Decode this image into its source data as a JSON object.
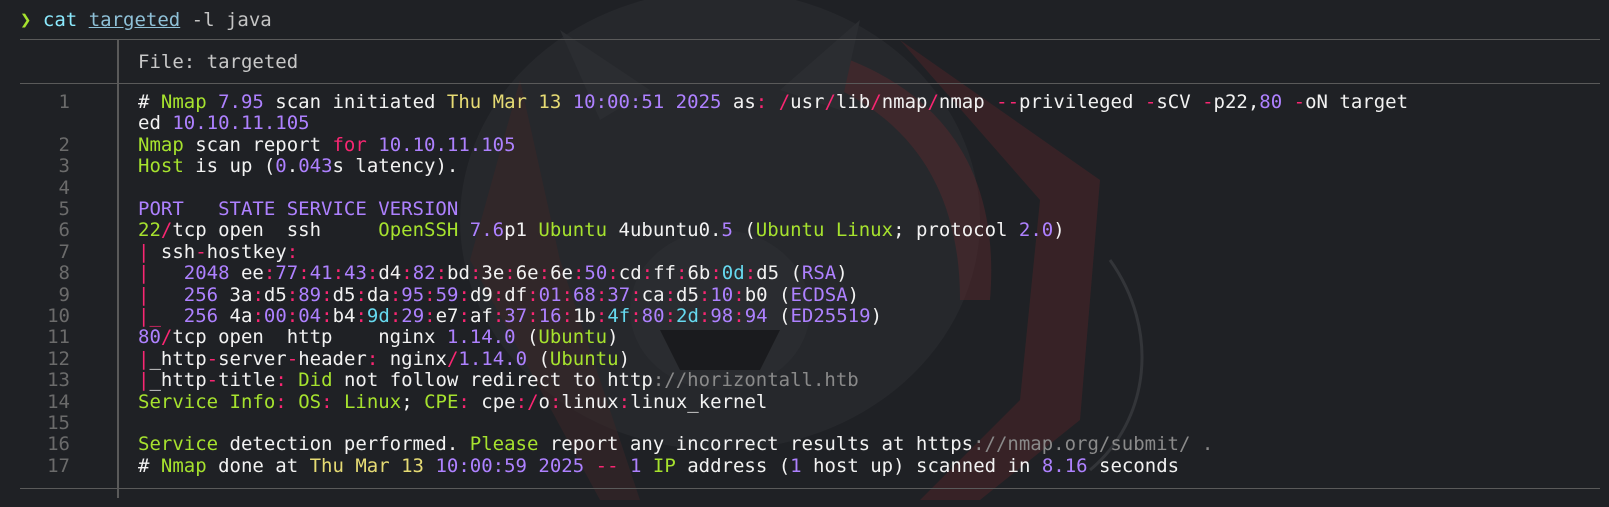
{
  "prompt": {
    "arrow": "❯",
    "command": "cat",
    "file_arg": "targeted",
    "flags": "-l java"
  },
  "file_header": "File: targeted",
  "line_numbers": [
    "1",
    "",
    "2",
    "3",
    "4",
    "5",
    "6",
    "7",
    "8",
    "9",
    "10",
    "11",
    "12",
    "13",
    "14",
    "15",
    "16",
    "17"
  ],
  "lines": [
    [
      [
        "w",
        "# "
      ],
      [
        "g",
        "Nmap "
      ],
      [
        "p",
        "7.95"
      ],
      [
        "w",
        " scan initiated "
      ],
      [
        "y",
        "Thu Mar 13 "
      ],
      [
        "p",
        "10:00:51 2025"
      ],
      [
        "w",
        " as"
      ],
      [
        "r",
        ":"
      ],
      [
        "w",
        " "
      ],
      [
        "r",
        "/"
      ],
      [
        "w",
        "usr"
      ],
      [
        "r",
        "/"
      ],
      [
        "w",
        "lib"
      ],
      [
        "r",
        "/"
      ],
      [
        "w",
        "nmap"
      ],
      [
        "r",
        "/"
      ],
      [
        "w",
        "nmap "
      ],
      [
        "r",
        "--"
      ],
      [
        "w",
        "privileged "
      ],
      [
        "r",
        "-"
      ],
      [
        "w",
        "sCV "
      ],
      [
        "r",
        "-"
      ],
      [
        "w",
        "p22,"
      ],
      [
        "p",
        "80"
      ],
      [
        "w",
        " "
      ],
      [
        "r",
        "-"
      ],
      [
        "w",
        "oN target"
      ]
    ],
    [
      [
        "w",
        "ed "
      ],
      [
        "p",
        "10.10.11.105"
      ]
    ],
    [
      [
        "g",
        "Nmap"
      ],
      [
        "w",
        " scan report "
      ],
      [
        "r",
        "for"
      ],
      [
        "w",
        " "
      ],
      [
        "p",
        "10.10.11.105"
      ]
    ],
    [
      [
        "g",
        "Host"
      ],
      [
        "w",
        " is up ("
      ],
      [
        "p",
        "0"
      ],
      [
        "w",
        "."
      ],
      [
        "p",
        "043"
      ],
      [
        "w",
        "s latency)."
      ]
    ],
    [
      [
        "w",
        ""
      ]
    ],
    [
      [
        "p",
        "PORT   STATE SERVICE VERSION"
      ]
    ],
    [
      [
        "g",
        "22"
      ],
      [
        "r",
        "/"
      ],
      [
        "w",
        "tcp open  ssh     "
      ],
      [
        "g",
        "OpenSSH "
      ],
      [
        "p",
        "7.6"
      ],
      [
        "w",
        "p1 "
      ],
      [
        "g",
        "Ubuntu"
      ],
      [
        "w",
        " 4ubuntu0."
      ],
      [
        "p",
        "5"
      ],
      [
        "w",
        " ("
      ],
      [
        "g",
        "Ubuntu Linux"
      ],
      [
        "w",
        "; protocol "
      ],
      [
        "p",
        "2.0"
      ],
      [
        "w",
        ")"
      ]
    ],
    [
      [
        "r",
        "|"
      ],
      [
        "w",
        " ssh"
      ],
      [
        "r",
        "-"
      ],
      [
        "w",
        "hostkey"
      ],
      [
        "r",
        ":"
      ]
    ],
    [
      [
        "r",
        "|"
      ],
      [
        "w",
        "   "
      ],
      [
        "p",
        "2048"
      ],
      [
        "w",
        " ee"
      ],
      [
        "r",
        ":"
      ],
      [
        "p",
        "77"
      ],
      [
        "r",
        ":"
      ],
      [
        "p",
        "41"
      ],
      [
        "r",
        ":"
      ],
      [
        "p",
        "43"
      ],
      [
        "r",
        ":"
      ],
      [
        "w",
        "d4"
      ],
      [
        "r",
        ":"
      ],
      [
        "p",
        "82"
      ],
      [
        "r",
        ":"
      ],
      [
        "w",
        "bd"
      ],
      [
        "r",
        ":"
      ],
      [
        "w",
        "3e"
      ],
      [
        "r",
        ":"
      ],
      [
        "w",
        "6e"
      ],
      [
        "r",
        ":"
      ],
      [
        "w",
        "6e"
      ],
      [
        "r",
        ":"
      ],
      [
        "p",
        "50"
      ],
      [
        "r",
        ":"
      ],
      [
        "w",
        "cd"
      ],
      [
        "r",
        ":"
      ],
      [
        "w",
        "ff"
      ],
      [
        "r",
        ":"
      ],
      [
        "w",
        "6b"
      ],
      [
        "r",
        ":"
      ],
      [
        "c",
        "0d"
      ],
      [
        "r",
        ":"
      ],
      [
        "w",
        "d5 ("
      ],
      [
        "p",
        "RSA"
      ],
      [
        "w",
        ")"
      ]
    ],
    [
      [
        "r",
        "|"
      ],
      [
        "w",
        "   "
      ],
      [
        "p",
        "256"
      ],
      [
        "w",
        " 3a"
      ],
      [
        "r",
        ":"
      ],
      [
        "w",
        "d5"
      ],
      [
        "r",
        ":"
      ],
      [
        "p",
        "89"
      ],
      [
        "r",
        ":"
      ],
      [
        "w",
        "d5"
      ],
      [
        "r",
        ":"
      ],
      [
        "w",
        "da"
      ],
      [
        "r",
        ":"
      ],
      [
        "p",
        "95"
      ],
      [
        "r",
        ":"
      ],
      [
        "p",
        "59"
      ],
      [
        "r",
        ":"
      ],
      [
        "w",
        "d9"
      ],
      [
        "r",
        ":"
      ],
      [
        "w",
        "df"
      ],
      [
        "r",
        ":"
      ],
      [
        "p",
        "01"
      ],
      [
        "r",
        ":"
      ],
      [
        "p",
        "68"
      ],
      [
        "r",
        ":"
      ],
      [
        "p",
        "37"
      ],
      [
        "r",
        ":"
      ],
      [
        "w",
        "ca"
      ],
      [
        "r",
        ":"
      ],
      [
        "w",
        "d5"
      ],
      [
        "r",
        ":"
      ],
      [
        "p",
        "10"
      ],
      [
        "r",
        ":"
      ],
      [
        "w",
        "b0 ("
      ],
      [
        "p",
        "ECDSA"
      ],
      [
        "w",
        ")"
      ]
    ],
    [
      [
        "r",
        "|_"
      ],
      [
        "w",
        "  "
      ],
      [
        "p",
        "256"
      ],
      [
        "w",
        " 4a"
      ],
      [
        "r",
        ":"
      ],
      [
        "p",
        "00"
      ],
      [
        "r",
        ":"
      ],
      [
        "p",
        "04"
      ],
      [
        "r",
        ":"
      ],
      [
        "w",
        "b4"
      ],
      [
        "r",
        ":"
      ],
      [
        "c",
        "9d"
      ],
      [
        "r",
        ":"
      ],
      [
        "p",
        "29"
      ],
      [
        "r",
        ":"
      ],
      [
        "w",
        "e7"
      ],
      [
        "r",
        ":"
      ],
      [
        "w",
        "af"
      ],
      [
        "r",
        ":"
      ],
      [
        "p",
        "37"
      ],
      [
        "r",
        ":"
      ],
      [
        "p",
        "16"
      ],
      [
        "r",
        ":"
      ],
      [
        "w",
        "1b"
      ],
      [
        "r",
        ":"
      ],
      [
        "c",
        "4f"
      ],
      [
        "r",
        ":"
      ],
      [
        "p",
        "80"
      ],
      [
        "r",
        ":"
      ],
      [
        "c",
        "2d"
      ],
      [
        "r",
        ":"
      ],
      [
        "p",
        "98"
      ],
      [
        "r",
        ":"
      ],
      [
        "p",
        "94"
      ],
      [
        "w",
        " ("
      ],
      [
        "p",
        "ED25519"
      ],
      [
        "w",
        ")"
      ]
    ],
    [
      [
        "p",
        "80"
      ],
      [
        "r",
        "/"
      ],
      [
        "w",
        "tcp open  http    nginx "
      ],
      [
        "p",
        "1.14.0"
      ],
      [
        "w",
        " ("
      ],
      [
        "g",
        "Ubuntu"
      ],
      [
        "w",
        ")"
      ]
    ],
    [
      [
        "r",
        "|"
      ],
      [
        "w",
        "_http"
      ],
      [
        "r",
        "-"
      ],
      [
        "w",
        "server"
      ],
      [
        "r",
        "-"
      ],
      [
        "w",
        "header"
      ],
      [
        "r",
        ":"
      ],
      [
        "w",
        " nginx"
      ],
      [
        "r",
        "/"
      ],
      [
        "p",
        "1.14.0"
      ],
      [
        "w",
        " ("
      ],
      [
        "g",
        "Ubuntu"
      ],
      [
        "w",
        ")"
      ]
    ],
    [
      [
        "r",
        "|"
      ],
      [
        "w",
        "_http"
      ],
      [
        "r",
        "-"
      ],
      [
        "w",
        "title"
      ],
      [
        "r",
        ":"
      ],
      [
        "w",
        " "
      ],
      [
        "g",
        "Did"
      ],
      [
        "w",
        " not follow redirect to http"
      ],
      [
        "d",
        "://horizontall.htb"
      ]
    ],
    [
      [
        "g",
        "Service Info"
      ],
      [
        "r",
        ":"
      ],
      [
        "w",
        " "
      ],
      [
        "g",
        "OS"
      ],
      [
        "r",
        ":"
      ],
      [
        "w",
        " "
      ],
      [
        "g",
        "Linux"
      ],
      [
        "w",
        "; "
      ],
      [
        "g",
        "CPE"
      ],
      [
        "r",
        ":"
      ],
      [
        "w",
        " cpe"
      ],
      [
        "r",
        ":/"
      ],
      [
        "w",
        "o"
      ],
      [
        "r",
        ":"
      ],
      [
        "w",
        "linux"
      ],
      [
        "r",
        ":"
      ],
      [
        "w",
        "linux_kernel"
      ]
    ],
    [
      [
        "w",
        ""
      ]
    ],
    [
      [
        "g",
        "Service"
      ],
      [
        "w",
        " detection performed. "
      ],
      [
        "g",
        "Please"
      ],
      [
        "w",
        " report any incorrect results at https"
      ],
      [
        "d",
        "://nmap.org/submit/ ."
      ]
    ],
    [
      [
        "w",
        "# "
      ],
      [
        "g",
        "Nmap"
      ],
      [
        "w",
        " done at "
      ],
      [
        "y",
        "Thu Mar 13 "
      ],
      [
        "p",
        "10:00:59 2025"
      ],
      [
        "w",
        " "
      ],
      [
        "r",
        "--"
      ],
      [
        "w",
        " "
      ],
      [
        "p",
        "1"
      ],
      [
        "w",
        " "
      ],
      [
        "g",
        "IP"
      ],
      [
        "w",
        " address ("
      ],
      [
        "p",
        "1"
      ],
      [
        "w",
        " host up) scanned in "
      ],
      [
        "p",
        "8.16"
      ],
      [
        "w",
        " seconds"
      ]
    ]
  ]
}
